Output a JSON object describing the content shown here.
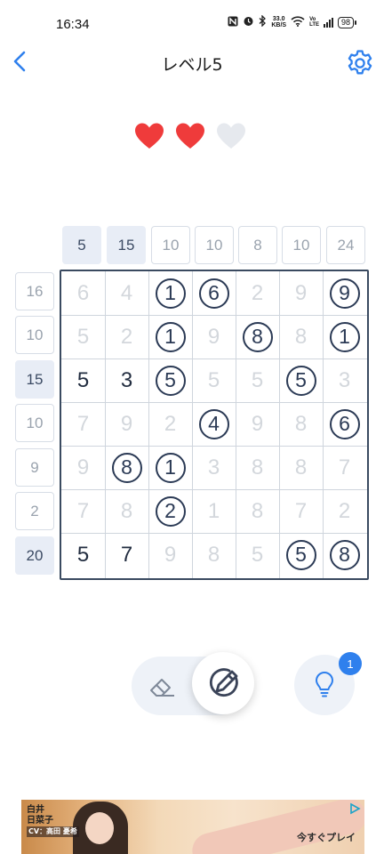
{
  "status_bar": {
    "time": "16:34",
    "net_speed_value": "33.0",
    "net_speed_unit": "KB/S",
    "volte_top": "Vo",
    "volte_bottom": "LTE",
    "battery": "98"
  },
  "header": {
    "title": "レベル5",
    "back_icon": "chevron-left-icon",
    "settings_icon": "gear-icon"
  },
  "lives": {
    "filled": 2,
    "total": 3,
    "filled_color": "#ef3b3b",
    "empty_color": "#e6e9ee"
  },
  "column_clues": [
    {
      "value": "5",
      "done": true
    },
    {
      "value": "15",
      "done": true
    },
    {
      "value": "10",
      "done": false
    },
    {
      "value": "10",
      "done": false
    },
    {
      "value": "8",
      "done": false
    },
    {
      "value": "10",
      "done": false
    },
    {
      "value": "24",
      "done": false
    }
  ],
  "row_clues": [
    {
      "value": "16",
      "done": false
    },
    {
      "value": "10",
      "done": false
    },
    {
      "value": "15",
      "done": true
    },
    {
      "value": "10",
      "done": false
    },
    {
      "value": "9",
      "done": false
    },
    {
      "value": "2",
      "done": false
    },
    {
      "value": "20",
      "done": true
    }
  ],
  "grid": [
    [
      {
        "v": "6",
        "s": "dim"
      },
      {
        "v": "4",
        "s": "dim"
      },
      {
        "v": "1",
        "s": "kept"
      },
      {
        "v": "6",
        "s": "kept"
      },
      {
        "v": "2",
        "s": "dim"
      },
      {
        "v": "9",
        "s": "dim"
      },
      {
        "v": "9",
        "s": "kept"
      }
    ],
    [
      {
        "v": "5",
        "s": "dim"
      },
      {
        "v": "2",
        "s": "dim"
      },
      {
        "v": "1",
        "s": "kept"
      },
      {
        "v": "9",
        "s": "dim"
      },
      {
        "v": "8",
        "s": "kept"
      },
      {
        "v": "8",
        "s": "dim"
      },
      {
        "v": "1",
        "s": "kept"
      }
    ],
    [
      {
        "v": "5",
        "s": "sel"
      },
      {
        "v": "3",
        "s": "sel"
      },
      {
        "v": "5",
        "s": "kept"
      },
      {
        "v": "5",
        "s": "dim"
      },
      {
        "v": "5",
        "s": "dim"
      },
      {
        "v": "5",
        "s": "kept"
      },
      {
        "v": "3",
        "s": "dim"
      }
    ],
    [
      {
        "v": "7",
        "s": "dim"
      },
      {
        "v": "9",
        "s": "dim"
      },
      {
        "v": "2",
        "s": "dim"
      },
      {
        "v": "4",
        "s": "kept"
      },
      {
        "v": "9",
        "s": "dim"
      },
      {
        "v": "8",
        "s": "dim"
      },
      {
        "v": "6",
        "s": "kept"
      }
    ],
    [
      {
        "v": "9",
        "s": "dim"
      },
      {
        "v": "8",
        "s": "kept"
      },
      {
        "v": "1",
        "s": "kept"
      },
      {
        "v": "3",
        "s": "dim"
      },
      {
        "v": "8",
        "s": "dim"
      },
      {
        "v": "8",
        "s": "dim"
      },
      {
        "v": "7",
        "s": "dim"
      }
    ],
    [
      {
        "v": "7",
        "s": "dim"
      },
      {
        "v": "8",
        "s": "dim"
      },
      {
        "v": "2",
        "s": "kept"
      },
      {
        "v": "1",
        "s": "dim"
      },
      {
        "v": "8",
        "s": "dim"
      },
      {
        "v": "7",
        "s": "dim"
      },
      {
        "v": "2",
        "s": "dim"
      }
    ],
    [
      {
        "v": "5",
        "s": "sel"
      },
      {
        "v": "7",
        "s": "sel"
      },
      {
        "v": "9",
        "s": "dim"
      },
      {
        "v": "8",
        "s": "dim"
      },
      {
        "v": "5",
        "s": "dim"
      },
      {
        "v": "5",
        "s": "kept"
      },
      {
        "v": "8",
        "s": "kept"
      }
    ]
  ],
  "controls": {
    "eraser_icon": "eraser-icon",
    "pencil_icon": "pencil-icon",
    "hint_icon": "lightbulb-icon",
    "hint_count": "1",
    "accent": "#2f80ed"
  },
  "ad": {
    "name_line1": "白井",
    "name_line2": "日菜子",
    "cv_line": "CV：高田 憂希",
    "cta": "今すぐプレイ",
    "choice_icon": "ad-choices-icon"
  }
}
